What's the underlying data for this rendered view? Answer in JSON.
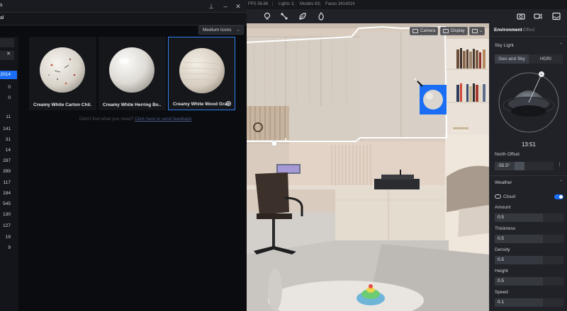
{
  "window": {
    "title_fragment": "s",
    "subtitle_fragment": "al",
    "pin_icon": "pin-icon",
    "controls": [
      "minimize-icon",
      "maximize-icon",
      "close-icon"
    ]
  },
  "status": {
    "fps": "FPS 56.66",
    "lights": "Lights 1",
    "models": "Models 83",
    "faces": "Faces 3414314"
  },
  "view_mode": {
    "selected": "Medium Icons"
  },
  "category_counts": [
    "2014",
    "0",
    "0",
    "11",
    "141",
    "31",
    "14",
    "287",
    "399",
    "117",
    "184",
    "545",
    "130",
    "127",
    "19",
    "9"
  ],
  "category_active_index": 0,
  "materials": [
    {
      "name": "Creamy White Carton Chil...",
      "selected": false
    },
    {
      "name": "Creamy White Herring Bo...",
      "selected": false
    },
    {
      "name": "Creamy White Wood Grain",
      "selected": true
    }
  ],
  "feedback": {
    "text": "Didn't find what you need?",
    "link": "Click here to send feedback"
  },
  "viewport_buttons": {
    "camera": "Camera",
    "display": "Display"
  },
  "environment_panel": {
    "tabs": [
      "Environment",
      "Effect"
    ],
    "active_tab": "Environment",
    "sky_light": {
      "title": "Sky Light",
      "modes": [
        "Geo and Sky",
        "HDRI"
      ],
      "active_mode": "Geo and Sky",
      "time": "13:51",
      "north_offset_label": "North Offset",
      "north_offset_value": "-55.5°"
    },
    "weather": {
      "title": "Weather",
      "cloud_label": "Cloud",
      "cloud_enabled": true,
      "fields": [
        {
          "label": "Amount",
          "value": "0.5"
        },
        {
          "label": "Thickness",
          "value": "0.5"
        },
        {
          "label": "Density",
          "value": "0.5"
        },
        {
          "label": "Height",
          "value": "0.5"
        },
        {
          "label": "Speed",
          "value": "0.1"
        }
      ]
    }
  },
  "colors": {
    "accent": "#1b6ef3",
    "selection_outline": "#2f7ff3",
    "panel_bg": "#202227",
    "dark_bg": "#0b0c0f"
  }
}
